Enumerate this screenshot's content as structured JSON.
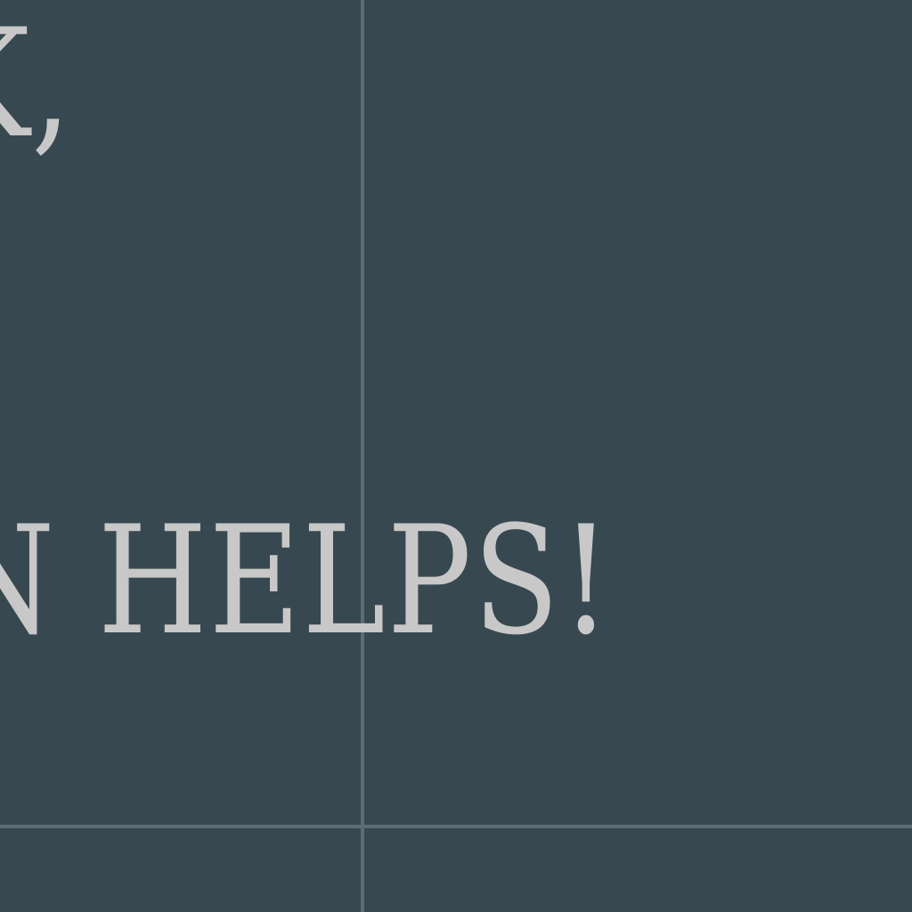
{
  "background_color": "#374850",
  "guide_color": "#5c6d73",
  "text_color": "#c8c8c8",
  "text": {
    "line1": "K,",
    "line2": "N HELPS!"
  }
}
